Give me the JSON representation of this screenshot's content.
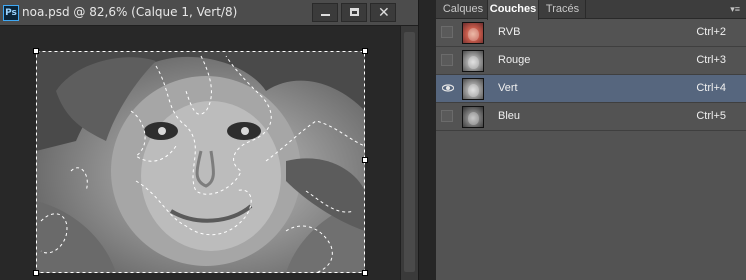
{
  "document": {
    "app_icon": "Ps",
    "title": "noa.psd @ 82,6% (Calque 1, Vert/8)",
    "window_buttons": [
      "minimize-icon",
      "maximize-icon",
      "close-icon"
    ]
  },
  "panel": {
    "tabs": [
      {
        "label": "Calques",
        "active": false
      },
      {
        "label": "Couches",
        "active": true
      },
      {
        "label": "Tracés",
        "active": false
      }
    ],
    "menu_icon": "panel-menu-icon",
    "channels": [
      {
        "name": "RVB",
        "shortcut": "Ctrl+2",
        "visible": false,
        "selected": false,
        "thumbnail": "color"
      },
      {
        "name": "Rouge",
        "shortcut": "Ctrl+3",
        "visible": false,
        "selected": false,
        "thumbnail": "gray"
      },
      {
        "name": "Vert",
        "shortcut": "Ctrl+4",
        "visible": true,
        "selected": true,
        "thumbnail": "gray"
      },
      {
        "name": "Bleu",
        "shortcut": "Ctrl+5",
        "visible": false,
        "selected": false,
        "thumbnail": "dark"
      }
    ]
  },
  "colors": {
    "selection_highlight": "#56667e",
    "panel_bg": "#535353",
    "active_tab_bg": "#535353"
  }
}
